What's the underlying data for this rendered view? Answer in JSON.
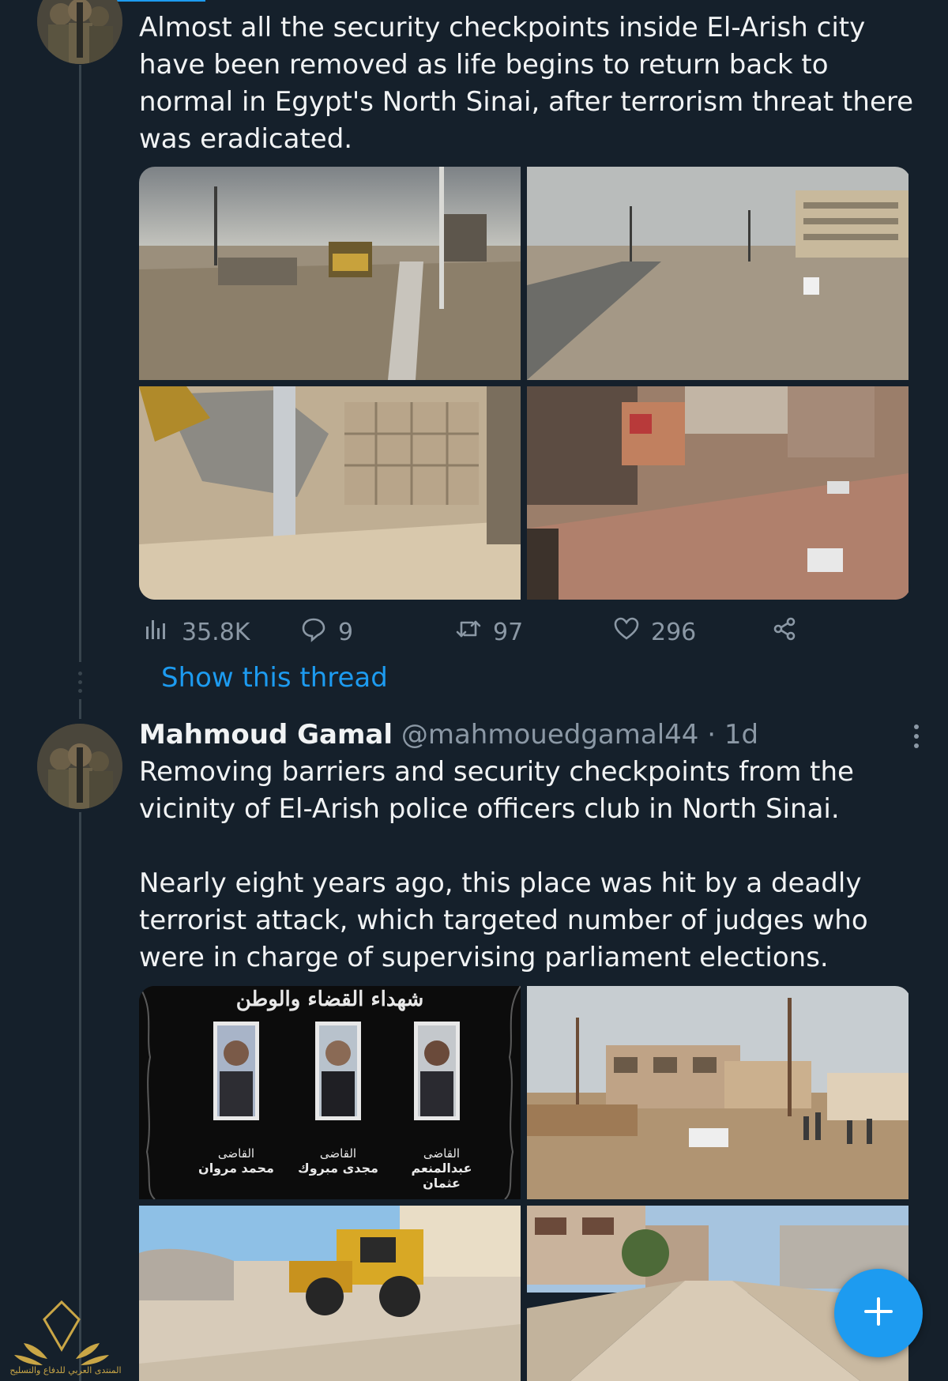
{
  "tweet1": {
    "text": "Almost all the security checkpoints inside El-Arish city have been removed as life begins to return back to normal in Egypt's North Sinai, after terrorism threat there was eradicated.",
    "media": [
      {
        "kind": "photo",
        "subject": "road with bulldozer and lamp posts"
      },
      {
        "kind": "photo",
        "subject": "cleared street with puddles and buildings"
      },
      {
        "kind": "photo",
        "subject": "bulldozer bucket near barrier blocks"
      },
      {
        "kind": "photo",
        "subject": "aerial view of cleared street with cars"
      }
    ],
    "stats": {
      "views": "35.8K",
      "replies": "9",
      "retweets": "97",
      "likes": "296"
    },
    "show_thread": "Show this thread"
  },
  "tweet2": {
    "author_name": "Mahmoud Gamal",
    "author_handle": "@mahmouedgamal44",
    "separator": "·",
    "time": "1d",
    "text": "Removing barriers and security checkpoints from the vicinity of El-Arish police officers club in North Sinai.\n\nNearly eight years ago, this place was hit by a deadly terrorist attack, which targeted number of judges who were in charge of supervising parliament elections.",
    "media": [
      {
        "kind": "memorial-poster",
        "heading": "شهداء القضاء والوطن",
        "people": [
          {
            "title": "القاضى",
            "name": "محمد مروان"
          },
          {
            "title": "القاضى",
            "name": "مجدى مبروك"
          },
          {
            "title": "القاضى",
            "name": "عبدالمنعم عثمان"
          }
        ]
      },
      {
        "kind": "photo",
        "subject": "damaged buildings and people on street"
      },
      {
        "kind": "photo",
        "subject": "yellow bulldozer clearing debris"
      },
      {
        "kind": "photo",
        "subject": "dirt road between buildings"
      }
    ]
  },
  "watermark": {
    "text": "المنتدى العربي للدفاع والتسليح"
  },
  "icons": {
    "views": "bar-chart-icon",
    "replies": "speech-bubble-icon",
    "retweets": "retweet-icon",
    "likes": "heart-icon",
    "share": "share-icon",
    "compose": "plus-icon",
    "more": "more-vertical-icon"
  },
  "colors": {
    "background": "#15202b",
    "accent": "#1d9bf0",
    "text": "#e7e9ea",
    "muted": "#8b98a5"
  }
}
